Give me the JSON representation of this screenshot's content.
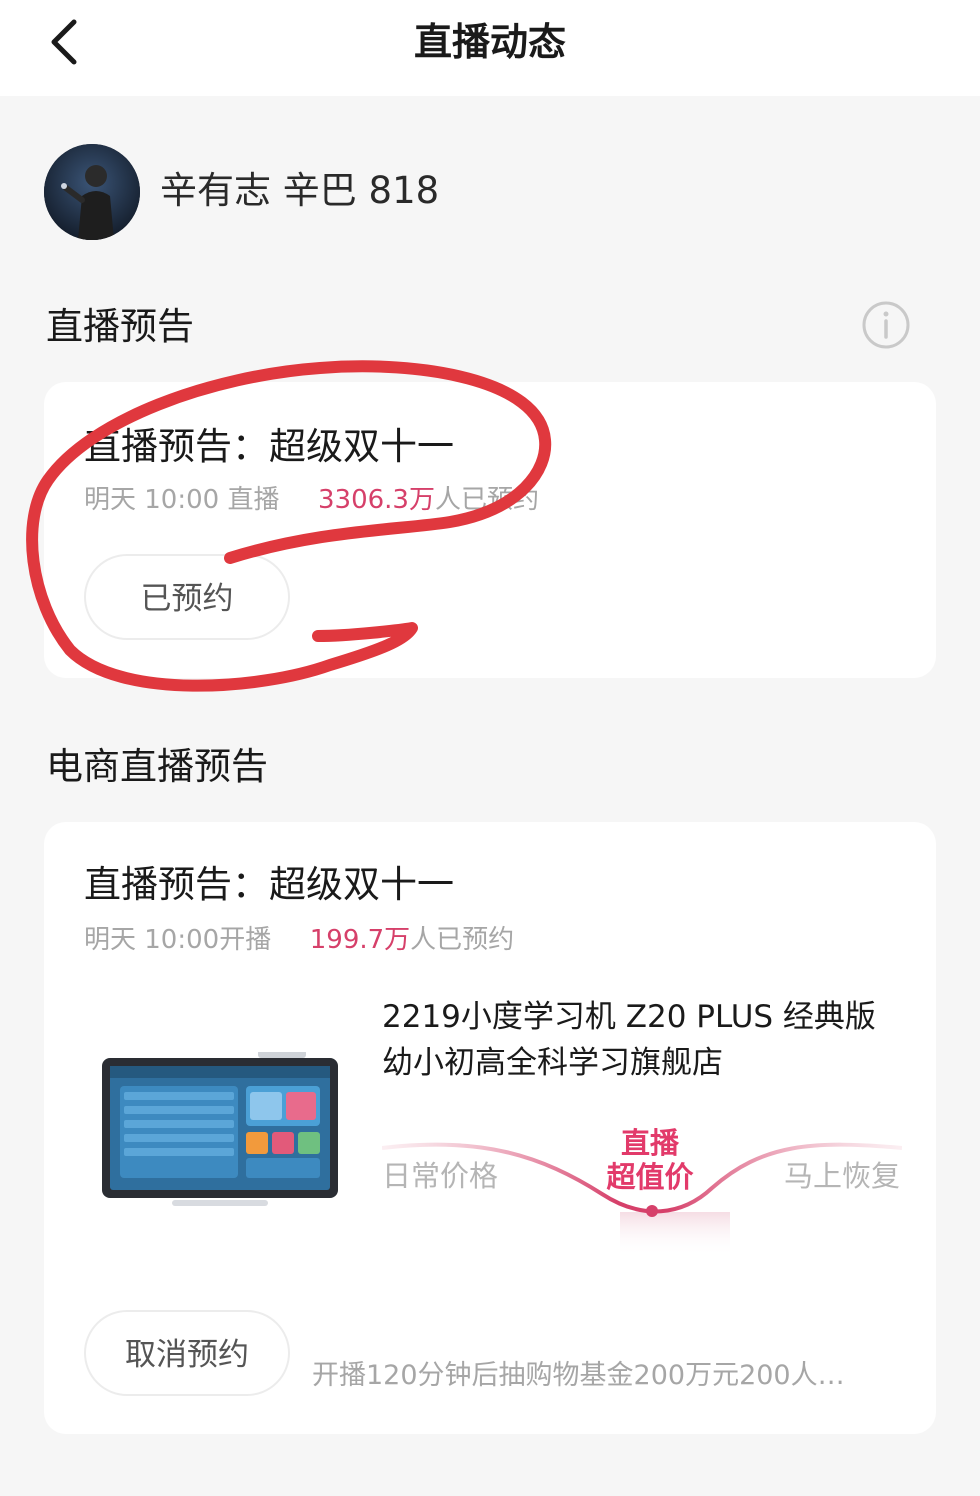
{
  "header": {
    "title": "直播动态"
  },
  "host": {
    "name": "辛有志 辛巴 818"
  },
  "live_preview_section": {
    "title": "直播预告",
    "card": {
      "title": "直播预告：超级双十一",
      "time_text": "明天 10:00 直播",
      "reservation_count": "3306.3万",
      "reservation_suffix": "人已预约",
      "button_label": "已预约"
    }
  },
  "ecommerce_section": {
    "title": "电商直播预告",
    "card": {
      "title": "直播预告：超级双十一",
      "time_text": "明天 10:00开播",
      "reservation_count": "199.7万",
      "reservation_suffix": "人已预约",
      "product_name_line1": "2219小度学习机 Z20 PLUS 经典版",
      "product_name_line2": "幼小初高全科学习旗舰店",
      "price_label_regular": "日常价格",
      "price_label_live_line1": "直播",
      "price_label_live_line2": "超值价",
      "price_label_restore": "马上恢复",
      "button_label": "取消预约",
      "promo_text": "开播120分钟后抽购物基金200万元200人…"
    }
  },
  "colors": {
    "accent": "#d6406a",
    "annotation_red": "#e0383e",
    "background": "#f6f6f6"
  }
}
